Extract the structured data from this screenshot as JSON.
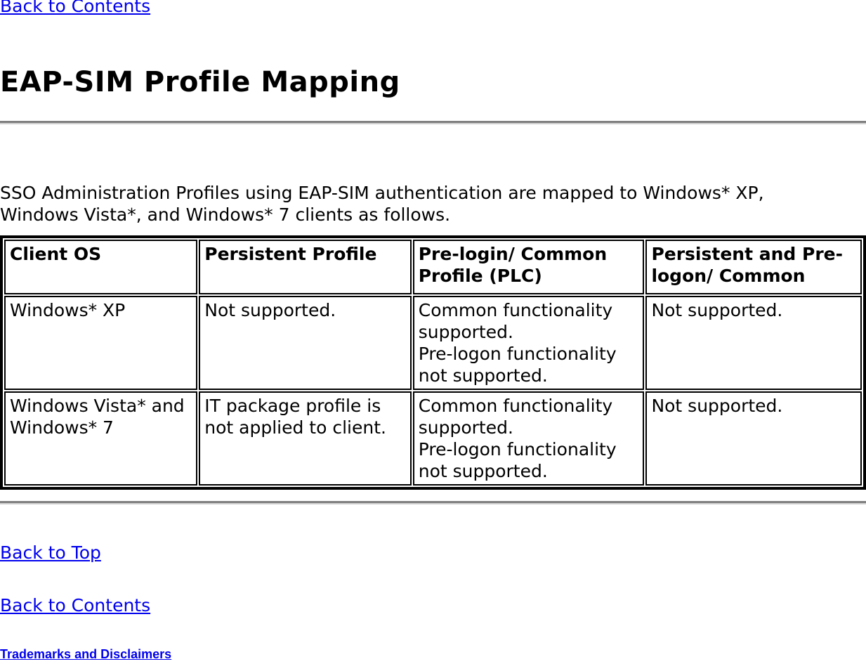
{
  "nav": {
    "back_to_contents_top": "Back to Contents",
    "back_to_top": "Back to Top",
    "back_to_contents_bottom": "Back to Contents",
    "trademarks": "Trademarks and Disclaimers"
  },
  "header": {
    "title": "EAP-SIM Profile Mapping"
  },
  "intro": {
    "text": "SSO Administration Profiles using EAP-SIM authentication are mapped to Windows* XP, Windows Vista*, and Windows* 7 clients as follows."
  },
  "table": {
    "columns": [
      "Client OS",
      "Persistent Profile",
      "Pre-login/ Common Profile (PLC)",
      "Persistent and Pre-logon/ Common"
    ],
    "rows": [
      {
        "client_os": "Windows* XP",
        "persistent_profile": "Not supported.",
        "plc_line1": "Common functionality supported.",
        "plc_line2": "Pre-logon functionality not supported.",
        "persistent_and_prelogon": "Not supported."
      },
      {
        "client_os": "Windows Vista* and Windows* 7",
        "persistent_profile": "IT package profile is not applied to client.",
        "plc_line1": "Common functionality supported.",
        "plc_line2": "Pre-logon functionality not supported.",
        "persistent_and_prelogon": "Not supported."
      }
    ]
  },
  "colors": {
    "link": "#0000EE",
    "text": "#000000",
    "rule_dark": "#808080",
    "rule_light": "#d4d4d4",
    "table_border": "#000000",
    "background": "#ffffff"
  }
}
